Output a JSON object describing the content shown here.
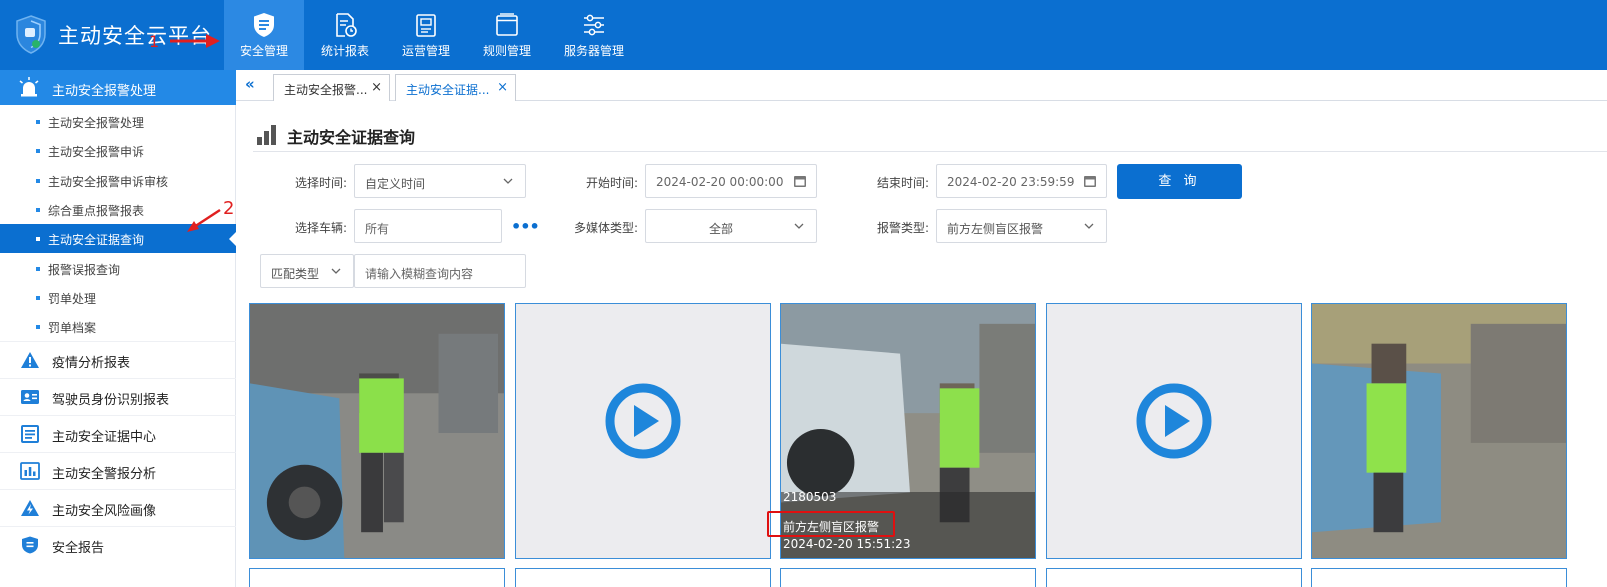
{
  "brand": {
    "title": "主动安全云平台"
  },
  "topnav": [
    {
      "label": "安全管理",
      "icon": "shield-list-icon",
      "active": true
    },
    {
      "label": "统计报表",
      "icon": "report-clock-icon"
    },
    {
      "label": "运营管理",
      "icon": "panel-icon"
    },
    {
      "label": "规则管理",
      "icon": "window-icon"
    },
    {
      "label": "服务器管理",
      "icon": "sliders-icon"
    }
  ],
  "sidebar": {
    "group": {
      "label": "主动安全报警处理",
      "icon": "alarm-light-icon"
    },
    "sub_items": [
      {
        "label": "主动安全报警处理"
      },
      {
        "label": "主动安全报警申诉"
      },
      {
        "label": "主动安全报警申诉审核"
      },
      {
        "label": "综合重点报警报表"
      },
      {
        "label": "主动安全证据查询",
        "active": true
      },
      {
        "label": "报警误报查询"
      },
      {
        "label": "罚单处理"
      },
      {
        "label": "罚单档案"
      }
    ],
    "main_items": [
      {
        "label": "疫情分析报表",
        "icon": "warning-triangle-icon"
      },
      {
        "label": "驾驶员身份识别报表",
        "icon": "id-card-icon"
      },
      {
        "label": "主动安全证据中心",
        "icon": "document-list-icon"
      },
      {
        "label": "主动安全警报分析",
        "icon": "bar-chart-icon"
      },
      {
        "label": "主动安全风险画像",
        "icon": "lightning-triangle-icon"
      },
      {
        "label": "安全报告",
        "icon": "shield-report-icon"
      }
    ]
  },
  "tabs": [
    {
      "label": "主动安全报警...",
      "close": "×"
    },
    {
      "label": "主动安全证据...",
      "close": "×",
      "active": true
    }
  ],
  "collapse_glyph": "«",
  "page": {
    "title": "主动安全证据查询"
  },
  "filters": {
    "select_time_label": "选择时间:",
    "select_time_value": "自定义时间",
    "start_time_label": "开始时间:",
    "start_time_value": "2024-02-20 00:00:00",
    "end_time_label": "结束时间:",
    "end_time_value": "2024-02-20 23:59:59",
    "query_button": "查 询",
    "vehicle_label": "选择车辆:",
    "vehicle_value": "所有",
    "more_glyph": "•••",
    "media_type_label": "多媒体类型:",
    "media_type_value": "全部",
    "alarm_type_label": "报警类型:",
    "alarm_type_value": "前方左侧盲区报警",
    "match_type_value": "匹配类型",
    "fuzzy_placeholder": "请输入模糊查询内容"
  },
  "cards": [
    {
      "type": "image"
    },
    {
      "type": "video"
    },
    {
      "type": "image",
      "overlay": {
        "vehicle": "2180503",
        "alarm": "前方左侧盲区报警",
        "time": "2024-02-20 15:51:23"
      }
    },
    {
      "type": "video"
    },
    {
      "type": "image"
    }
  ],
  "annotations": {
    "one": "1",
    "two": "2"
  },
  "colors": {
    "primary": "#0b6fd0",
    "sidebar_head": "#2389e6",
    "highlight": "#e01010"
  }
}
